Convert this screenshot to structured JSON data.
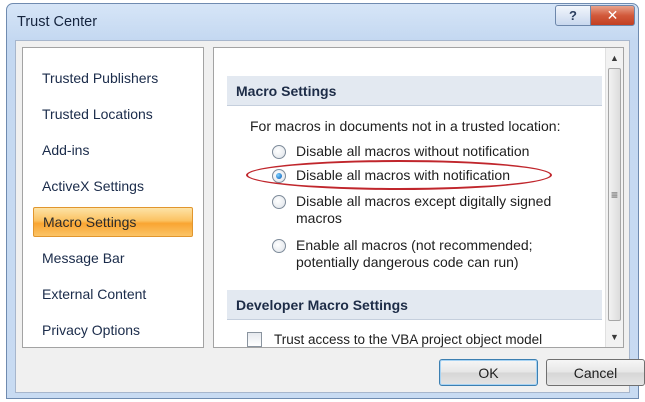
{
  "window": {
    "title": "Trust Center",
    "help_label": "?",
    "close_label": "✕"
  },
  "nav": {
    "items": [
      {
        "label": "Trusted Publishers"
      },
      {
        "label": "Trusted Locations"
      },
      {
        "label": "Add-ins"
      },
      {
        "label": "ActiveX Settings"
      },
      {
        "label": "Macro Settings",
        "selected": true
      },
      {
        "label": "Message Bar"
      },
      {
        "label": "External Content"
      },
      {
        "label": "Privacy Options"
      }
    ]
  },
  "macro_settings": {
    "header": "Macro Settings",
    "intro": "For macros in documents not in a trusted location:",
    "options": [
      {
        "label": "Disable all macros without notification",
        "checked": false
      },
      {
        "label": "Disable all macros with notification",
        "checked": true
      },
      {
        "label": "Disable all macros except digitally signed macros",
        "checked": false
      },
      {
        "label": "Enable all macros (not recommended; potentially dangerous code can run)",
        "checked": false
      }
    ]
  },
  "developer_settings": {
    "header": "Developer Macro Settings",
    "vba_label": "Trust access to the VBA project object model",
    "vba_checked": false
  },
  "buttons": {
    "ok": "OK",
    "cancel": "Cancel"
  },
  "colors": {
    "selected_nav": "#f9a532",
    "highlight_ring": "#c0262c",
    "close_button": "#c23f22"
  }
}
